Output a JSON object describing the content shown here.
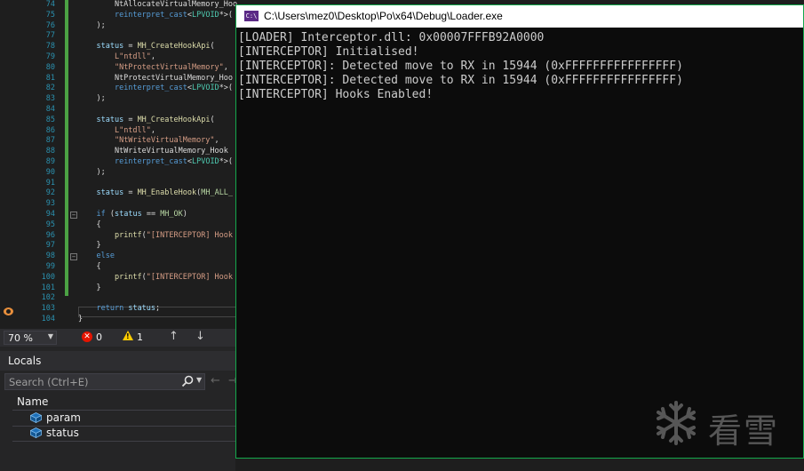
{
  "editor": {
    "line_numbers": [
      "74",
      "75",
      "76",
      "77",
      "78",
      "79",
      "80",
      "81",
      "82",
      "83",
      "84",
      "85",
      "86",
      "87",
      "88",
      "89",
      "90",
      "91",
      "92",
      "93",
      "94",
      "95",
      "96",
      "97",
      "98",
      "99",
      "100",
      "101",
      "102",
      "103",
      "104"
    ],
    "lines": [
      "        NtAllocateVirtualMemory_Hoo",
      "        reinterpret_cast<LPVOID*>(",
      "    );",
      "",
      "    status = MH_CreateHookApi(",
      "        L\"ntdll\",",
      "        \"NtProtectVirtualMemory\",",
      "        NtProtectVirtualMemory_Hoo",
      "        reinterpret_cast<LPVOID*>(",
      "    );",
      "",
      "    status = MH_CreateHookApi(",
      "        L\"ntdll\",",
      "        \"NtWriteVirtualMemory\",",
      "        NtWriteVirtualMemory_Hook",
      "        reinterpret_cast<LPVOID*>(",
      "    );",
      "",
      "    status = MH_EnableHook(MH_ALL_",
      "",
      "    if (status == MH_OK)",
      "    {",
      "        printf(\"[INTERCEPTOR] Hook",
      "    }",
      "    else",
      "    {",
      "        printf(\"[INTERCEPTOR] Hook",
      "    }",
      "",
      "    return status;",
      "}"
    ]
  },
  "status_bar": {
    "zoom": "70 %",
    "error_count": "0",
    "warning_count": "1"
  },
  "locals": {
    "title": "Locals",
    "search_placeholder": "Search (Ctrl+E)",
    "column_name": "Name",
    "variables": [
      "param",
      "status"
    ]
  },
  "console": {
    "title": "C:\\Users\\mez0\\Desktop\\Po\\x64\\Debug\\Loader.exe",
    "icon_text": "C:\\",
    "output": [
      "[LOADER] Interceptor.dll: 0x00007FFFB92A0000",
      "[INTERCEPTOR] Initialised!",
      "[INTERCEPTOR]: Detected move to RX in 15944 (0xFFFFFFFFFFFFFFFF)",
      "[INTERCEPTOR]: Detected move to RX in 15944 (0xFFFFFFFFFFFFFFFF)",
      "[INTERCEPTOR] Hooks Enabled!"
    ]
  },
  "watermark": {
    "text": "看雪"
  },
  "colors": {
    "console_border": "#14a84c",
    "change_bar": "#4ba144",
    "keyword": "#569cd6",
    "string": "#d69d85",
    "line_number": "#2b91af"
  }
}
